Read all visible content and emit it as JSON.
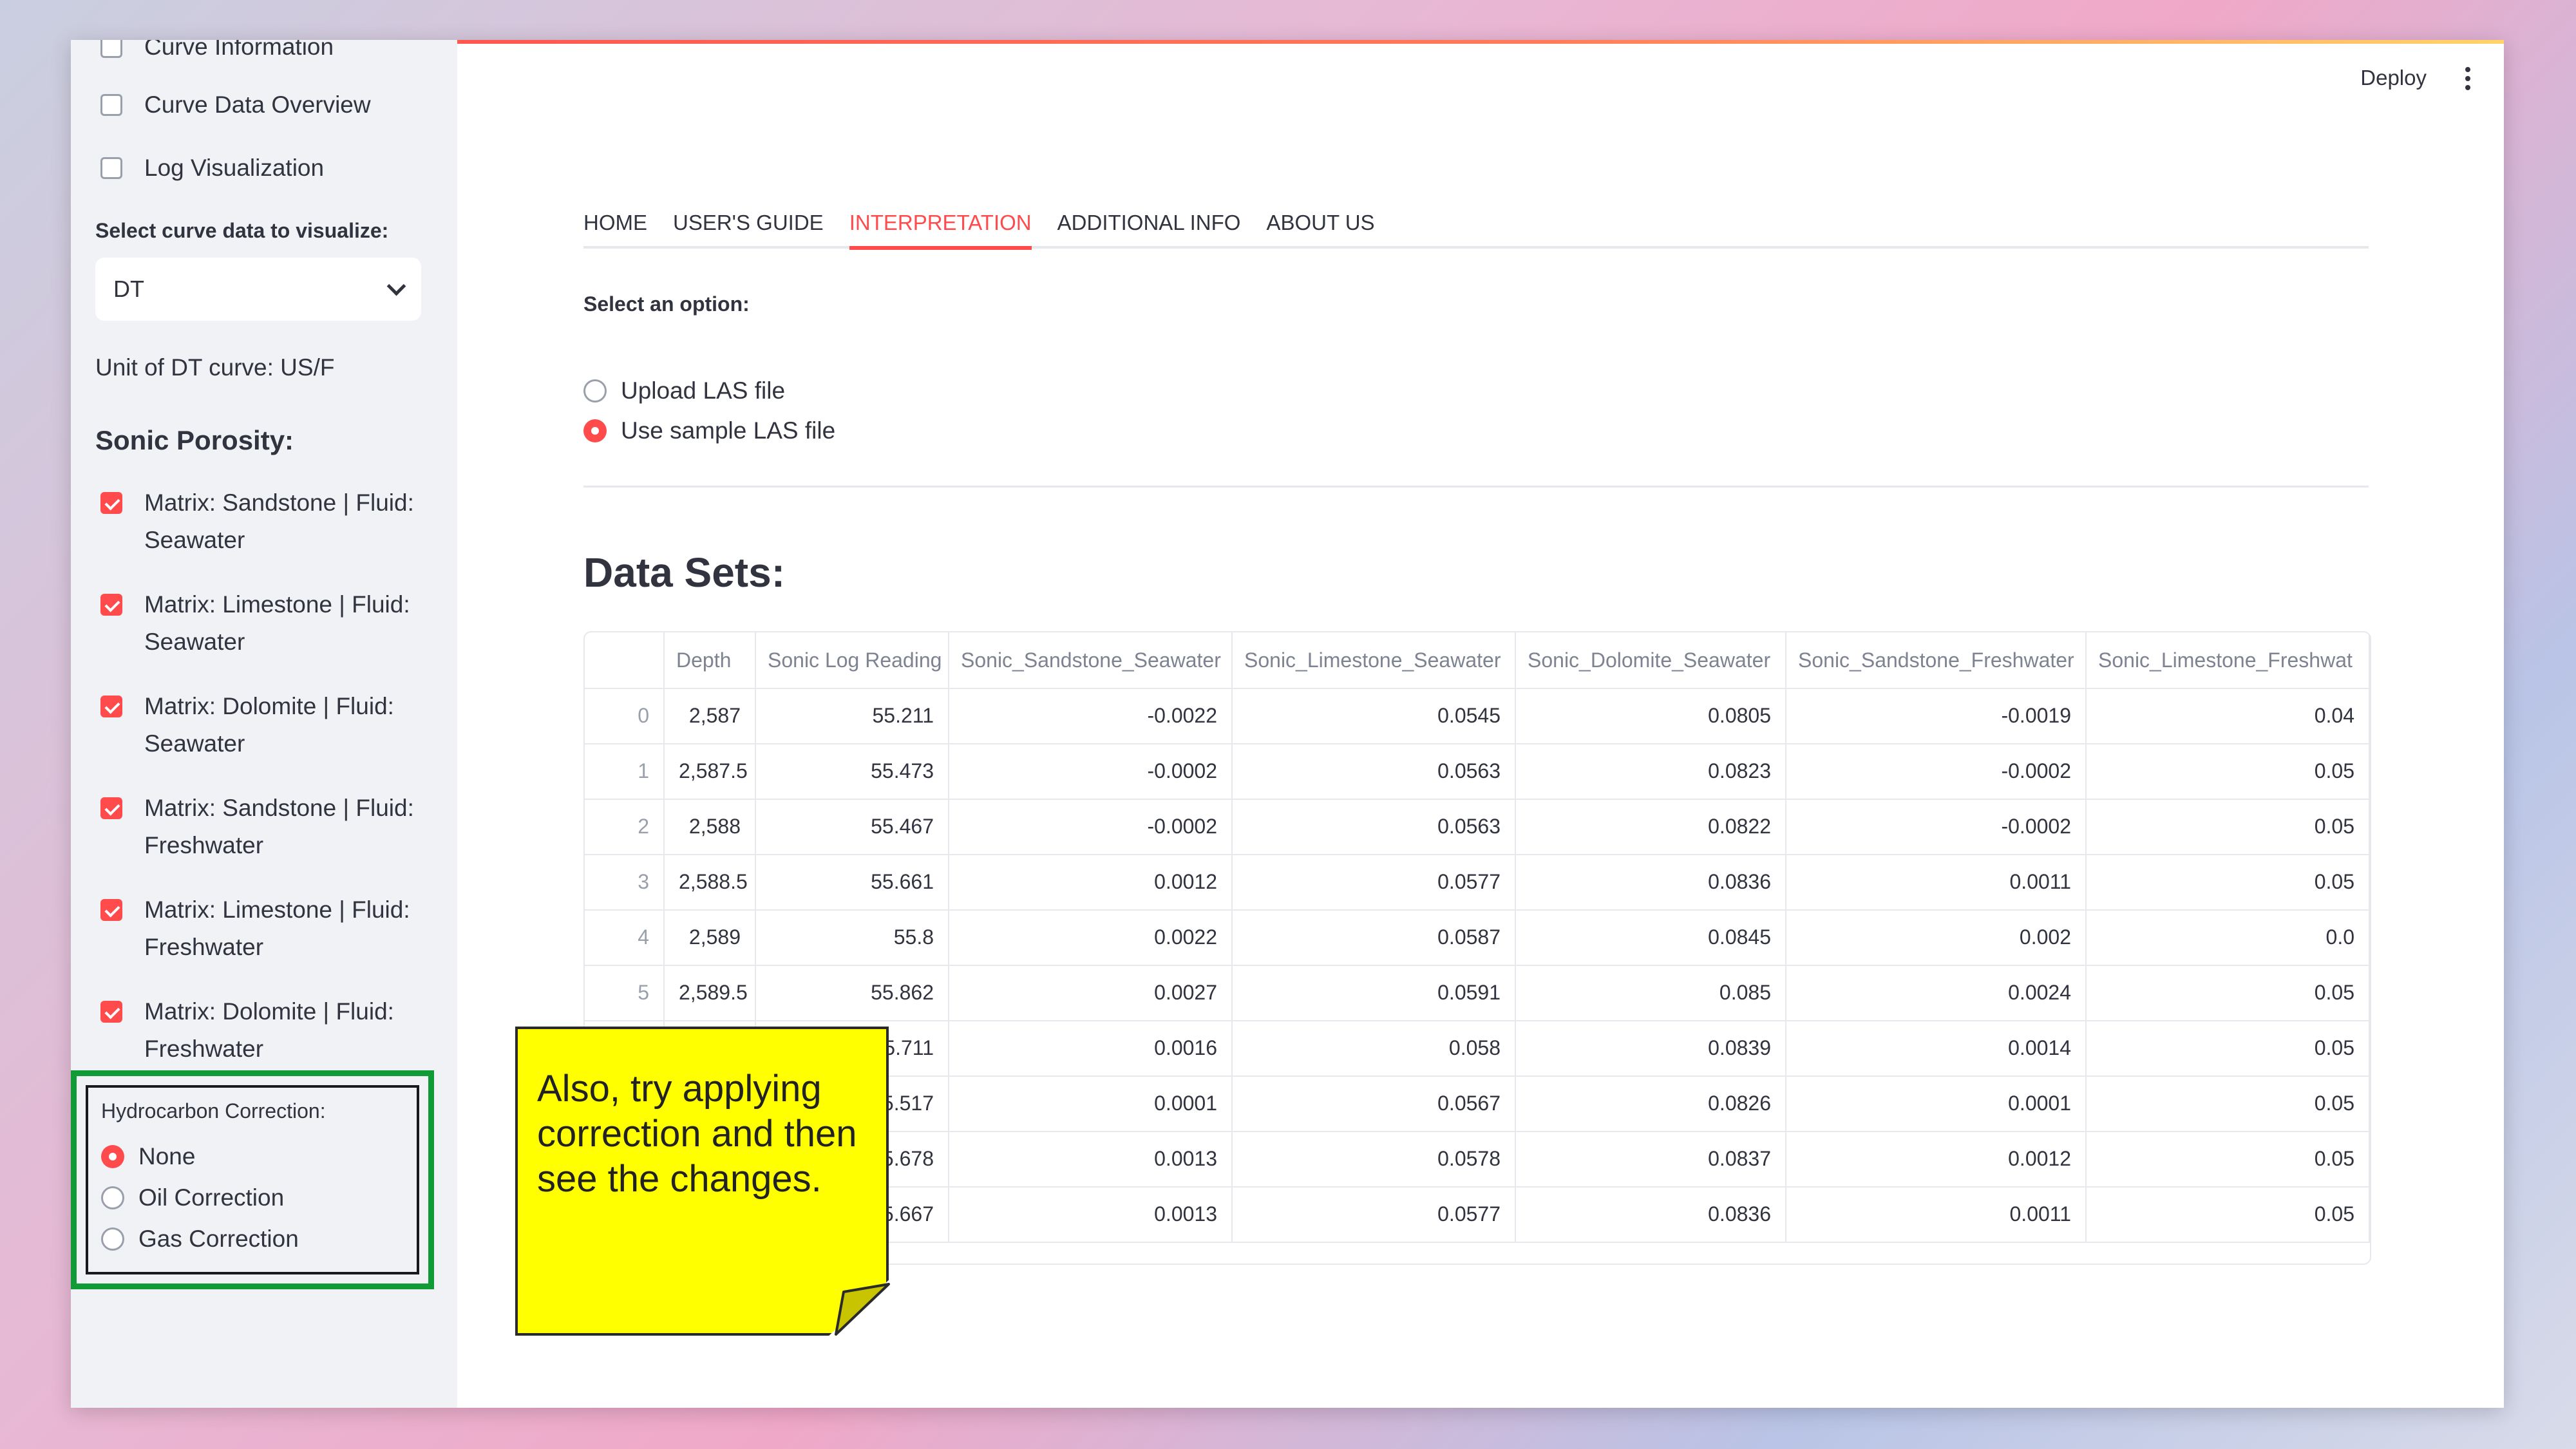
{
  "sidebar": {
    "checks_top": [
      {
        "label": "Curve Information",
        "checked": false
      },
      {
        "label": "Curve Data Overview",
        "checked": false
      },
      {
        "label": "Log Visualization",
        "checked": false
      }
    ],
    "select_label": "Select curve data to visualize:",
    "select_value": "DT",
    "unit_text": "Unit of DT curve: US/F",
    "porosity_heading": "Sonic Porosity:",
    "porosity_checks": [
      {
        "line1": "Matrix: Sandstone | Fluid:",
        "line2": "Seawater",
        "checked": true
      },
      {
        "line1": "Matrix: Limestone | Fluid:",
        "line2": "Seawater",
        "checked": true
      },
      {
        "line1": "Matrix: Dolomite | Fluid:",
        "line2": "Seawater",
        "checked": true
      },
      {
        "line1": "Matrix: Sandstone | Fluid:",
        "line2": "Freshwater",
        "checked": true
      },
      {
        "line1": "Matrix: Limestone | Fluid:",
        "line2": "Freshwater",
        "checked": true
      },
      {
        "line1": "Matrix: Dolomite | Fluid:",
        "line2": "Freshwater",
        "checked": true
      }
    ],
    "hc_label": "Hydrocarbon Correction:",
    "hc_options": [
      "None",
      "Oil Correction",
      "Gas Correction"
    ],
    "hc_selected": "None"
  },
  "header": {
    "deploy": "Deploy",
    "tabs": [
      "HOME",
      "USER'S GUIDE",
      "INTERPRETATION",
      "ADDITIONAL INFO",
      "ABOUT US"
    ],
    "active_tab": "INTERPRETATION"
  },
  "main": {
    "option_label": "Select an option:",
    "options": [
      "Upload LAS file",
      "Use sample LAS file"
    ],
    "selected_option": "Use sample LAS file",
    "datasets_title": "Data Sets:"
  },
  "table": {
    "columns": [
      "",
      "Depth",
      "Sonic Log Reading",
      "Sonic_Sandstone_Seawater",
      "Sonic_Limestone_Seawater",
      "Sonic_Dolomite_Seawater",
      "Sonic_Sandstone_Freshwater",
      "Sonic_Limestone_Freshwat"
    ],
    "rows": [
      [
        "0",
        "2,587",
        "55.211",
        "-0.0022",
        "0.0545",
        "0.0805",
        "-0.0019",
        "0.04"
      ],
      [
        "1",
        "2,587.5",
        "55.473",
        "-0.0002",
        "0.0563",
        "0.0823",
        "-0.0002",
        "0.05"
      ],
      [
        "2",
        "2,588",
        "55.467",
        "-0.0002",
        "0.0563",
        "0.0822",
        "-0.0002",
        "0.05"
      ],
      [
        "3",
        "2,588.5",
        "55.661",
        "0.0012",
        "0.0577",
        "0.0836",
        "0.0011",
        "0.05"
      ],
      [
        "4",
        "2,589",
        "55.8",
        "0.0022",
        "0.0587",
        "0.0845",
        "0.002",
        "0.0"
      ],
      [
        "5",
        "2,589.5",
        "55.862",
        "0.0027",
        "0.0591",
        "0.085",
        "0.0024",
        "0.05"
      ],
      [
        "",
        "",
        "5.711",
        "0.0016",
        "0.058",
        "0.0839",
        "0.0014",
        "0.05"
      ],
      [
        "",
        "",
        "5.517",
        "0.0001",
        "0.0567",
        "0.0826",
        "0.0001",
        "0.05"
      ],
      [
        "",
        "",
        "5.678",
        "0.0013",
        "0.0578",
        "0.0837",
        "0.0012",
        "0.05"
      ],
      [
        "",
        "",
        "5.667",
        "0.0013",
        "0.0577",
        "0.0836",
        "0.0011",
        "0.05"
      ]
    ]
  },
  "note": {
    "text": "Also, try applying correction and then see the changes."
  },
  "colors": {
    "accent": "#ff4b4b",
    "highlight_border": "#109a38",
    "note_bg": "#ffff00"
  }
}
